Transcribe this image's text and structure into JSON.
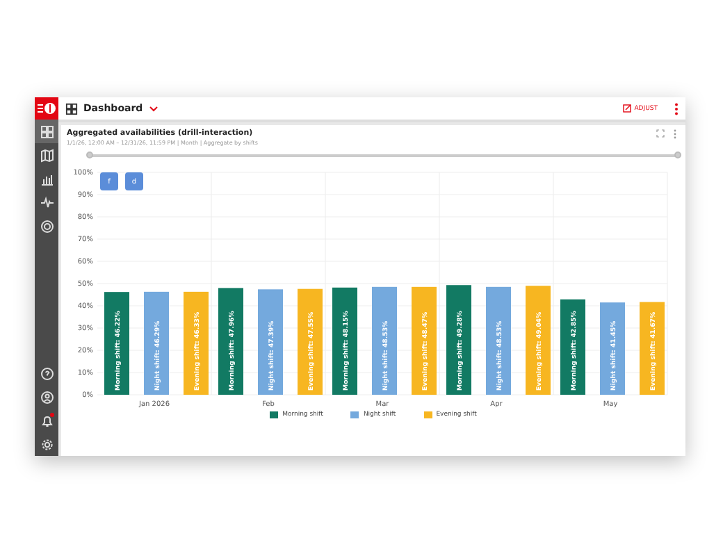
{
  "sidebar": {
    "items": [
      {
        "kind": "dashboard",
        "selected": true
      },
      {
        "kind": "map",
        "selected": false
      },
      {
        "kind": "bars",
        "selected": false
      },
      {
        "kind": "pulse",
        "selected": false
      },
      {
        "kind": "target",
        "selected": false
      }
    ],
    "bottom_items": [
      {
        "kind": "help",
        "badge": false
      },
      {
        "kind": "user",
        "badge": false
      },
      {
        "kind": "bell",
        "badge": true
      },
      {
        "kind": "gear",
        "badge": false
      }
    ]
  },
  "header": {
    "title": "Dashboard",
    "action": "ADJUST"
  },
  "card": {
    "title": "Aggregated availabilities (drill-interaction)",
    "subtitle": "1/1/26, 12:00 AM – 12/31/26, 11:59 PM | Month | Aggregate by shifts",
    "chart_buttons": [
      "f",
      "d"
    ],
    "slider": {
      "level": 1
    },
    "chart_data": {
      "type": "bar",
      "categories": [
        "Jan 2026",
        "Feb",
        "Mar",
        "Apr",
        "May"
      ],
      "series": [
        {
          "name": "Morning shift",
          "color": "#127a63",
          "values": [
            46.2,
            48.0,
            48.2,
            49.3,
            42.9
          ]
        },
        {
          "name": "Night shift",
          "color": "#74a9dd",
          "values": [
            46.3,
            47.4,
            48.5,
            48.5,
            41.5
          ]
        },
        {
          "name": "Evening shift",
          "color": "#f7b621",
          "values": [
            46.3,
            47.6,
            48.5,
            49.0,
            41.7
          ]
        }
      ],
      "ylim": [
        0,
        100
      ],
      "grid": true,
      "yticks": [
        {
          "value": 0,
          "label": "0%"
        },
        {
          "value": 10,
          "label": "10%"
        },
        {
          "value": 20,
          "label": "20%"
        },
        {
          "value": 30,
          "label": "30%"
        },
        {
          "value": 40,
          "label": "40%"
        },
        {
          "value": 50,
          "label": "50%"
        },
        {
          "value": 60,
          "label": "60%"
        },
        {
          "value": 70,
          "label": "70%"
        },
        {
          "value": 80,
          "label": "80%"
        },
        {
          "value": 90,
          "label": "90%"
        },
        {
          "value": 100,
          "label": "100%"
        }
      ],
      "data_labels": "value_labels",
      "value_labels": [
        [
          "Morning shift: 46.22%",
          "Morning shift: 47.96%",
          "Morning shift: 48.15%",
          "Morning shift: 49.28%",
          "Morning shift: 42.85%"
        ],
        [
          "Night shift: 46.29%",
          "Night shift: 47.39%",
          "Night shift: 48.53%",
          "Night shift: 48.53%",
          "Night shift: 41.45%"
        ],
        [
          "Evening shift: 46.33%",
          "Evening shift: 47.55%",
          "Evening shift: 48.47%",
          "Evening shift: 49.04%",
          "Evening shift: 41.67%"
        ]
      ]
    }
  }
}
